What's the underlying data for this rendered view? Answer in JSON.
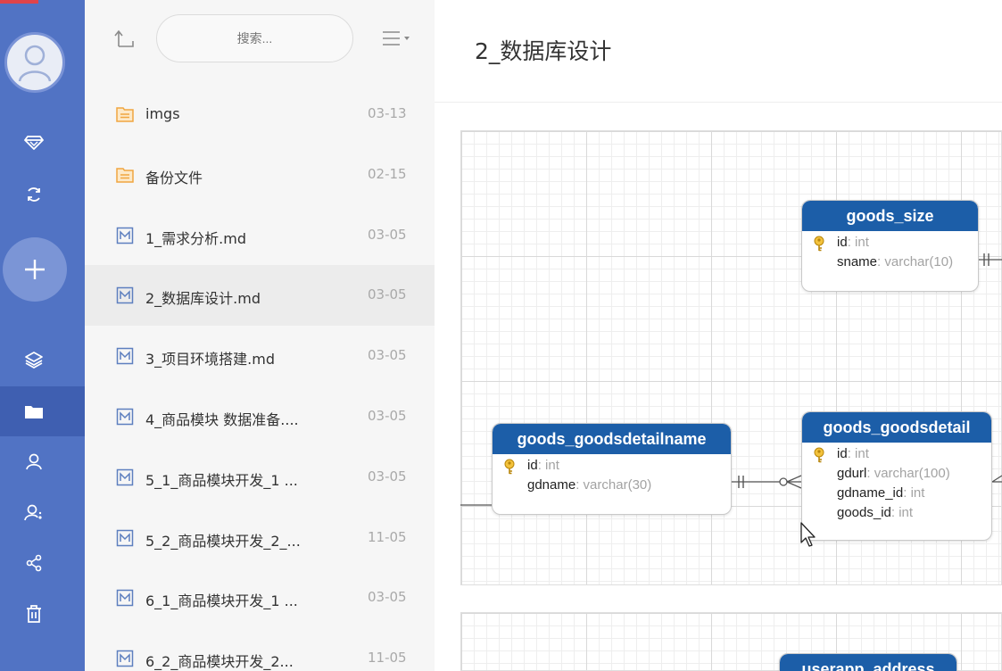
{
  "search": {
    "placeholder": "搜索..."
  },
  "files": [
    {
      "name": "imgs",
      "date": "03-13",
      "icon": "folder-icon"
    },
    {
      "name": "备份文件",
      "date": "02-15",
      "icon": "folder-icon"
    },
    {
      "name": "1_需求分析.md",
      "date": "03-05",
      "icon": "markdown-file-icon"
    },
    {
      "name": "2_数据库设计.md",
      "date": "03-05",
      "icon": "markdown-file-icon",
      "selected": true
    },
    {
      "name": "3_项目环境搭建.md",
      "date": "03-05",
      "icon": "markdown-file-icon"
    },
    {
      "name": "4_商品模块 数据准备....",
      "date": "03-05",
      "icon": "markdown-file-icon"
    },
    {
      "name": "5_1_商品模块开发_1 ...",
      "date": "03-05",
      "icon": "markdown-file-icon"
    },
    {
      "name": "5_2_商品模块开发_2_...",
      "date": "11-05",
      "icon": "markdown-file-icon"
    },
    {
      "name": "6_1_商品模块开发_1 ...",
      "date": "03-05",
      "icon": "markdown-file-icon"
    },
    {
      "name": "6_2_商品模块开发_2...",
      "date": "11-05",
      "icon": "markdown-file-icon"
    }
  ],
  "document": {
    "title": "2_数据库设计"
  },
  "diagram": {
    "tables": {
      "goods_size": {
        "name": "goods_size",
        "columns": [
          {
            "name": "id",
            "type": ": int",
            "pk": true
          },
          {
            "name": "sname",
            "type": ": varchar(10)"
          }
        ]
      },
      "goods_goodsdetailname": {
        "name": "goods_goodsdetailname",
        "columns": [
          {
            "name": "id",
            "type": ": int",
            "pk": true
          },
          {
            "name": "gdname",
            "type": ": varchar(30)"
          }
        ]
      },
      "goods_goodsdetail": {
        "name": "goods_goodsdetail",
        "columns": [
          {
            "name": "id",
            "type": ": int",
            "pk": true
          },
          {
            "name": "gdurl",
            "type": ": varchar(100)"
          },
          {
            "name": "gdname_id",
            "type": ": int"
          },
          {
            "name": "goods_id",
            "type": ": int"
          }
        ]
      },
      "userapp_address": {
        "name": "userapp_address"
      }
    }
  },
  "colors": {
    "rail": "#5173c4",
    "rail_active": "#3f5fb1",
    "table_header": "#1c5ea8",
    "folder": "#f0a640"
  }
}
